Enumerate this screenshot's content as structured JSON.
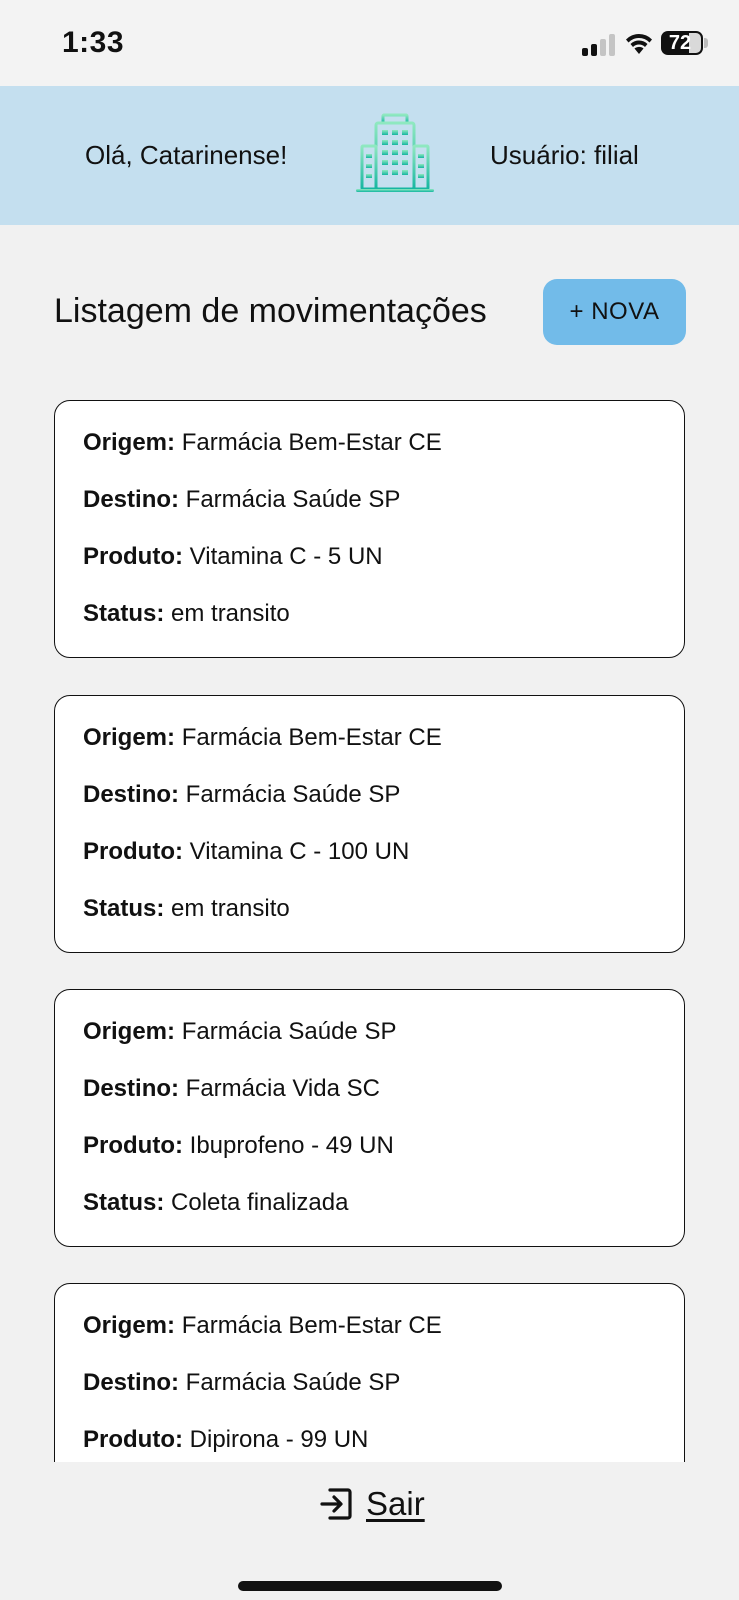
{
  "status_bar": {
    "time": "1:33",
    "battery": "72"
  },
  "header": {
    "greeting": "Olá, Catarinense!",
    "user": "Usuário: filial",
    "logo_icon": "building-icon"
  },
  "page": {
    "title": "Listagem de movimentações",
    "new_button": "+ NOVA"
  },
  "labels": {
    "origin": "Origem:",
    "destination": "Destino:",
    "product": "Produto:",
    "status": "Status:"
  },
  "movements": [
    {
      "origin": "Farmácia Bem-Estar CE",
      "destination": "Farmácia Saúde SP",
      "product": "Vitamina C - 5 UN",
      "status": "em transito"
    },
    {
      "origin": "Farmácia Bem-Estar CE",
      "destination": "Farmácia Saúde SP",
      "product": "Vitamina C - 100 UN",
      "status": "em transito"
    },
    {
      "origin": "Farmácia Saúde SP",
      "destination": "Farmácia Vida SC",
      "product": "Ibuprofeno - 49 UN",
      "status": "Coleta finalizada"
    },
    {
      "origin": "Farmácia Bem-Estar CE",
      "destination": "Farmácia Saúde SP",
      "product": "Dipirona - 99 UN",
      "status": ""
    }
  ],
  "footer": {
    "logout": "Sair",
    "logout_icon": "logout-icon"
  },
  "colors": {
    "header_bg": "#c4dfef",
    "button_bg": "#72bbe9",
    "page_bg": "#f1f1f1",
    "logo_gradient_top": "#7fe3b5",
    "logo_gradient_bottom": "#19b9a3"
  }
}
